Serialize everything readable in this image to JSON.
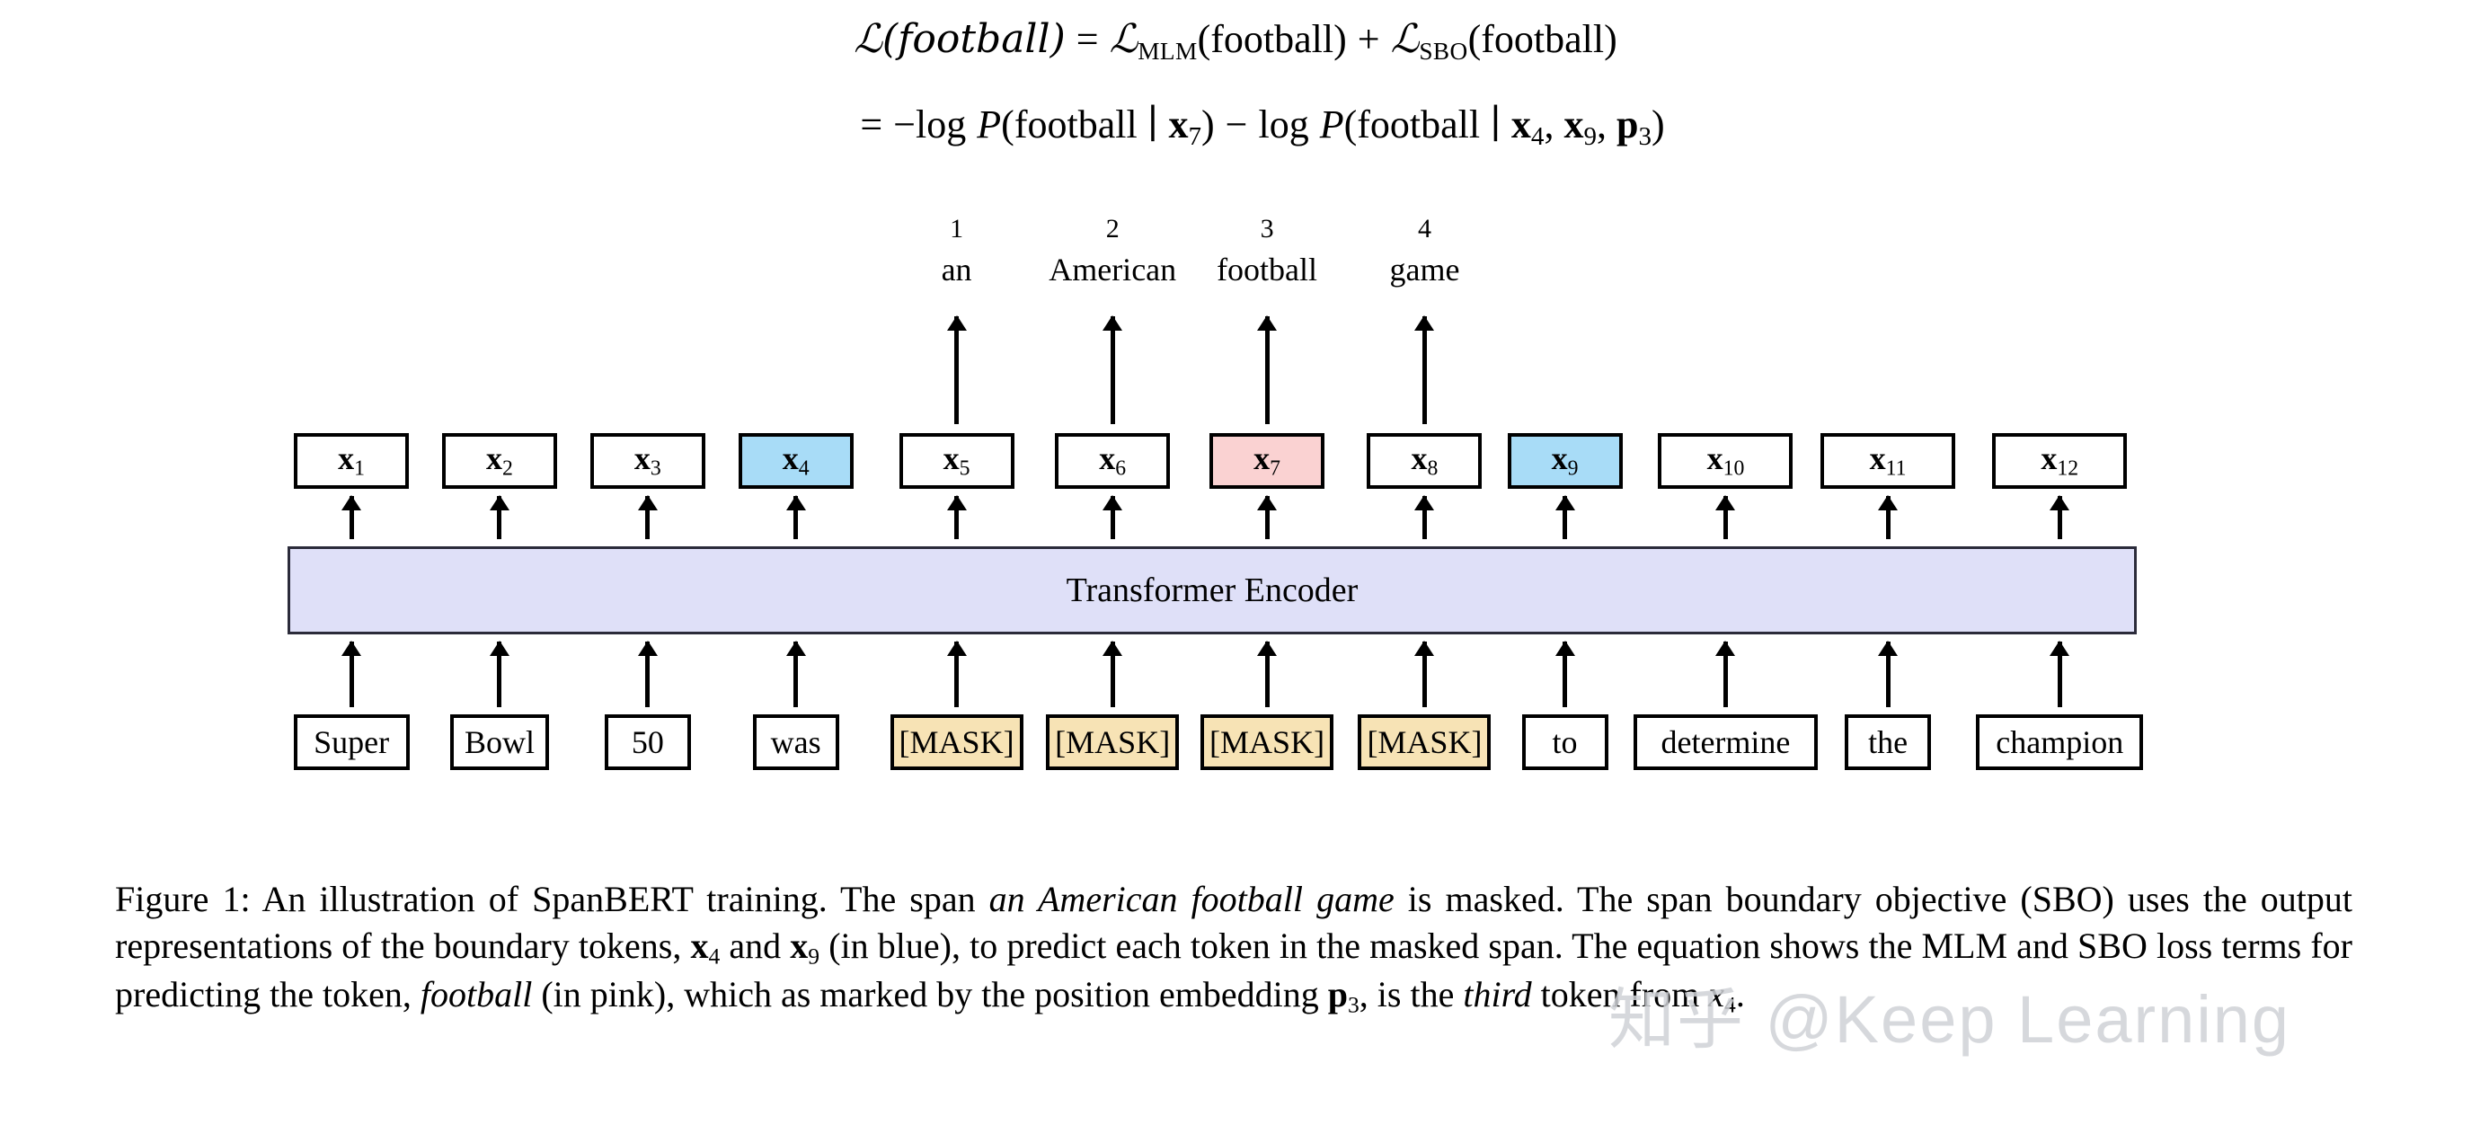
{
  "equations": {
    "line1": {
      "lhs": "ℒ(football)",
      "eq": "=",
      "term1": "ℒ",
      "term1_sub": "MLM",
      "term1_arg": "(football)",
      "plus": "+",
      "term2": "ℒ",
      "term2_sub": "SBO",
      "term2_arg": "(football)"
    },
    "line2": {
      "eq": "=",
      "minus": "−",
      "log1": "log",
      "p1": "P",
      "arg1_open": "(football ∣ ",
      "arg1_var": "x",
      "arg1_sub": "7",
      "arg1_close": ")",
      "minus2": "−",
      "log2": "log",
      "p2": "P",
      "arg2_open": "(football ∣ ",
      "arg2_v1": "x",
      "arg2_s1": "4",
      "arg2_comma1": ", ",
      "arg2_v2": "x",
      "arg2_s2": "9",
      "arg2_comma2": ", ",
      "arg2_v3": "p",
      "arg2_s3": "3",
      "arg2_close": ")"
    }
  },
  "diagram": {
    "encoder_label": "Transformer Encoder",
    "predictions": [
      {
        "index": "1",
        "word": "an"
      },
      {
        "index": "2",
        "word": "American"
      },
      {
        "index": "3",
        "word": "football"
      },
      {
        "index": "4",
        "word": "game"
      }
    ],
    "output_tokens": [
      {
        "var": "x",
        "sub": "1",
        "fill": "white"
      },
      {
        "var": "x",
        "sub": "2",
        "fill": "white"
      },
      {
        "var": "x",
        "sub": "3",
        "fill": "white"
      },
      {
        "var": "x",
        "sub": "4",
        "fill": "blue"
      },
      {
        "var": "x",
        "sub": "5",
        "fill": "white"
      },
      {
        "var": "x",
        "sub": "6",
        "fill": "white"
      },
      {
        "var": "x",
        "sub": "7",
        "fill": "pink"
      },
      {
        "var": "x",
        "sub": "8",
        "fill": "white"
      },
      {
        "var": "x",
        "sub": "9",
        "fill": "blue"
      },
      {
        "var": "x",
        "sub": "10",
        "fill": "white"
      },
      {
        "var": "x",
        "sub": "11",
        "fill": "white"
      },
      {
        "var": "x",
        "sub": "12",
        "fill": "white"
      }
    ],
    "input_tokens": [
      {
        "text": "Super",
        "fill": "white"
      },
      {
        "text": "Bowl",
        "fill": "white"
      },
      {
        "text": "50",
        "fill": "white"
      },
      {
        "text": "was",
        "fill": "white"
      },
      {
        "text": "[MASK]",
        "fill": "mask"
      },
      {
        "text": "[MASK]",
        "fill": "mask"
      },
      {
        "text": "[MASK]",
        "fill": "mask"
      },
      {
        "text": "[MASK]",
        "fill": "mask"
      },
      {
        "text": "to",
        "fill": "white"
      },
      {
        "text": "determine",
        "fill": "white"
      },
      {
        "text": "the",
        "fill": "white"
      },
      {
        "text": "champion",
        "fill": "white"
      }
    ]
  },
  "caption": {
    "label": "Figure 1:",
    "part1": " An illustration of SpanBERT training.  The span ",
    "italic1": "an American football game",
    "part2": " is masked.  The span boundary objective (SBO) uses the output representations of the boundary tokens, ",
    "var_x4": "x",
    "sub_4": "4",
    "part3": " and ",
    "var_x9": "x",
    "sub_9": "9",
    "part4": " (in blue), to predict each token in the masked span.  The equation shows the MLM and SBO loss terms for predicting the token, ",
    "italic2": "football",
    "part5": " (in pink), which as marked by the position embedding ",
    "var_p3": "p",
    "sub_3": "3",
    "part6": ", is the ",
    "italic3": "third",
    "part7": " token from ",
    "var_x4b": "x",
    "sub_4b": "4",
    "part8": "."
  },
  "watermark": {
    "text": "知乎 @Keep Learning"
  },
  "colors": {
    "blue_fill": "#a8dcf7",
    "pink_fill": "#fad2d2",
    "mask_fill": "#f7e3b5",
    "encoder_fill": "#dfe0f8",
    "border": "#000000",
    "watermark": "#cfd2d6"
  }
}
